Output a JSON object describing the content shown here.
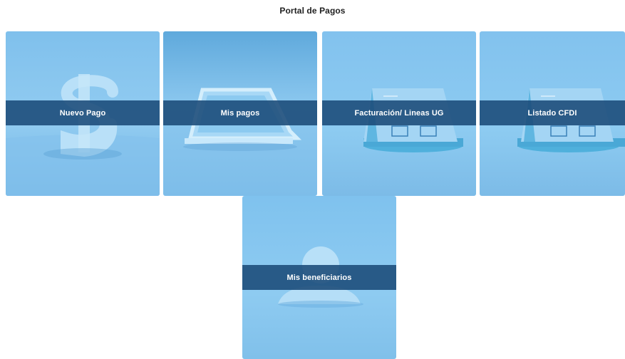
{
  "header": {
    "title": "Portal de Pagos"
  },
  "tiles": [
    {
      "label": "Nuevo Pago",
      "icon": "dollar-sign-icon"
    },
    {
      "label": "Mis pagos",
      "icon": "document-icon"
    },
    {
      "label": "Facturación/ Lineas UG",
      "icon": "invoice-stand-icon"
    },
    {
      "label": "Listado CFDI",
      "icon": "invoice-stand-icon"
    },
    {
      "label": "Mis beneficiarios",
      "icon": "person-icon"
    }
  ],
  "colors": {
    "tile_background": "#8cc8ef",
    "label_band": "#1a4a78",
    "title_text": "#1f1f1f"
  }
}
